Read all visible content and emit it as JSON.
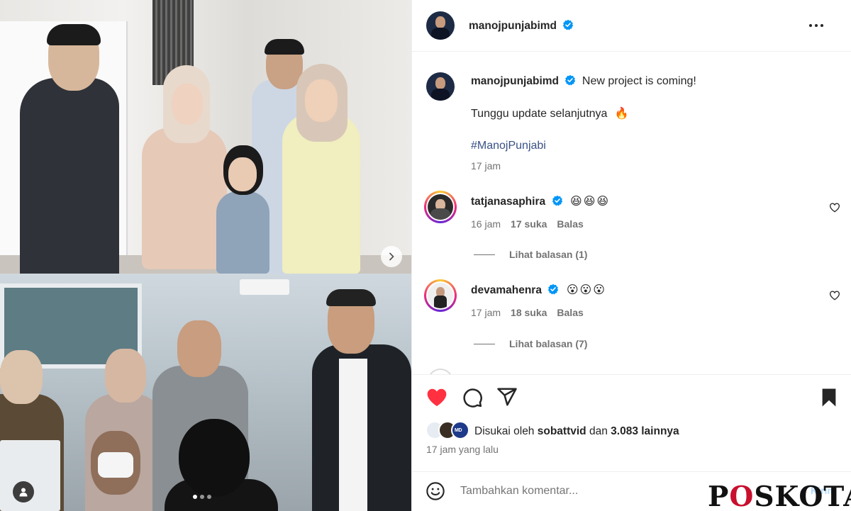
{
  "post": {
    "username": "manojpunjabimd",
    "more_icon": "more-horizontal-icon"
  },
  "caption": {
    "username": "manojpunjabimd",
    "line1": "New project is coming!",
    "line2": "Tunggu update selanjutnya",
    "line2_emoji": "🔥",
    "hashtag": "#ManojPunjabi",
    "time": "17 jam"
  },
  "comments": [
    {
      "username": "tatjanasaphira",
      "text": "😆😆😆",
      "time": "16 jam",
      "likes": "17 suka",
      "reply_label": "Balas",
      "view_replies": "Lihat balasan (1)"
    },
    {
      "username": "devamahenra",
      "text": "😮😮😮",
      "time": "17 jam",
      "likes": "18 suka",
      "reply_label": "Balas",
      "view_replies": "Lihat balasan (7)"
    }
  ],
  "actions": {
    "liked_by_prefix": "Disukai oleh",
    "liked_by_user": "sobattvid",
    "liked_by_connector": "dan",
    "others_count": "3.083 lainnya",
    "timestamp": "17 jam yang lalu",
    "liked": true,
    "saved": true
  },
  "comment_input": {
    "placeholder": "Tambahkan komentar...",
    "post_label": "Kirim"
  },
  "carousel": {
    "total": 3,
    "current": 1
  },
  "watermark": {
    "text_a": "P",
    "text_o": "O",
    "text_b": "SKOTA"
  },
  "colors": {
    "heart_red": "#ff3040",
    "verified_blue": "#0095f6",
    "link_blue": "#385185",
    "muted": "#737373"
  }
}
